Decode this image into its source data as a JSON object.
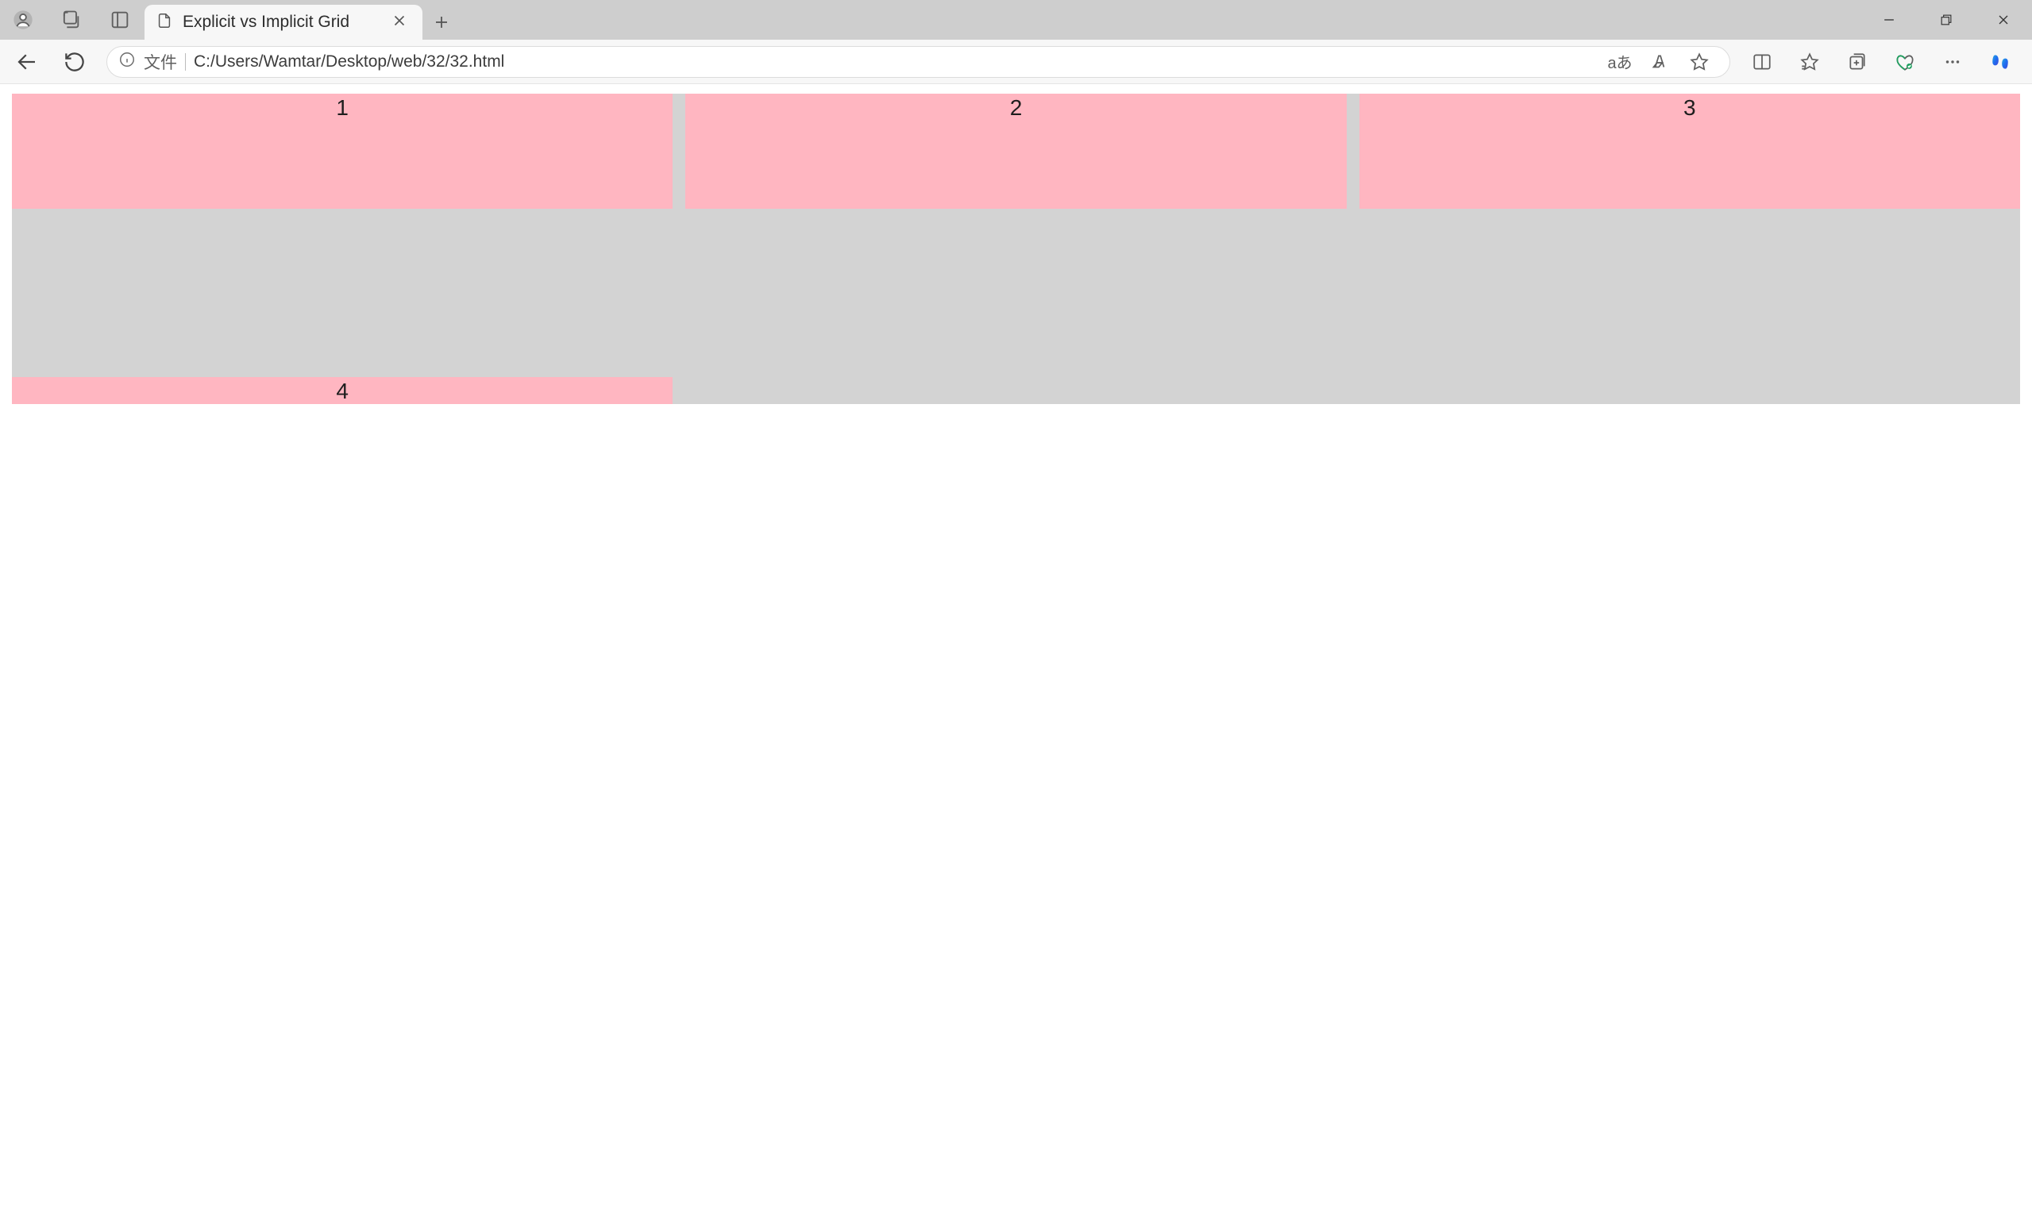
{
  "window": {
    "tab_title": "Explicit vs Implicit Grid",
    "address_label": "文件",
    "url": "C:/Users/Wamtar/Desktop/web/32/32.html"
  },
  "toolbar_icons": {
    "translate": "aあ"
  },
  "content": {
    "grid": {
      "cells": [
        "1",
        "2",
        "3",
        "4"
      ]
    }
  }
}
